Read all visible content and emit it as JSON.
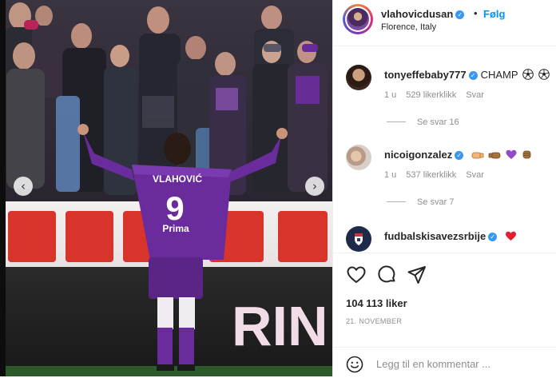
{
  "post": {
    "header": {
      "username": "vlahovicdusan",
      "follow_dot": "•",
      "follow_label": "Følg",
      "location": "Florence, Italy"
    },
    "photo": {
      "prev_arrow": "‹",
      "next_arrow": "›",
      "jersey_name": "VLAHOVIĆ",
      "jersey_number": "9",
      "sponsor": "Prima",
      "board_text": "RIN"
    },
    "comments": [
      {
        "username": "tonyeffebaby777",
        "text": "CHAMP",
        "emojis": [
          "soccer-ball-icon",
          "soccer-ball-icon"
        ],
        "age": "1 u",
        "likes": "529 likerklikk",
        "reply": "Svar",
        "view_replies": "Se svar 16"
      },
      {
        "username": "nicoigonzalez",
        "text": "",
        "emojis": [
          "fist-bump-left-icon",
          "fist-bump-right-icon",
          "purple-heart-icon",
          "fist-icon"
        ],
        "age": "1 u",
        "likes": "537 likerklikk",
        "reply": "Svar",
        "view_replies": "Se svar 7"
      },
      {
        "username": "fudbalskisavezsrbije",
        "text": "",
        "emojis": [
          "red-heart-icon"
        ]
      }
    ],
    "actions": {
      "icons": [
        "heart-icon",
        "comment-icon",
        "share-icon"
      ],
      "likes": "104 113 liker",
      "date": "21. NOVEMBER"
    },
    "add_comment": {
      "placeholder": "Legg til en kommentar ..."
    }
  },
  "colors": {
    "accent": "#0095f6",
    "verified": "#3897f0",
    "fiorentina_purple": "#6a2c9c"
  }
}
